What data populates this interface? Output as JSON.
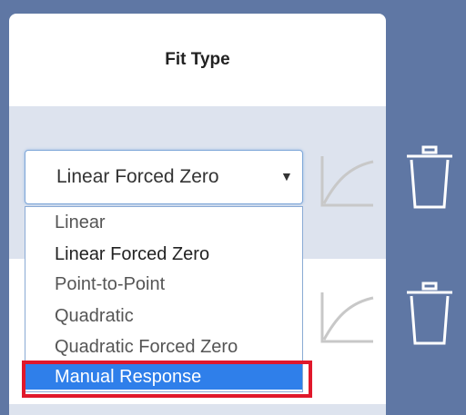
{
  "header": {
    "title": "Fit Type"
  },
  "select": {
    "value": "Linear Forced Zero",
    "arrow": "▼",
    "options": [
      "Linear",
      "Linear Forced Zero",
      "Point-to-Point",
      "Quadratic",
      "Quadratic Forced Zero",
      "Manual Response"
    ],
    "highlighted_option": "Manual Response"
  },
  "icons": {
    "row_1": [
      "curve-chart-icon",
      "trash-icon"
    ],
    "row_2": [
      "curve-chart-icon",
      "trash-icon"
    ]
  },
  "colors": {
    "background": "#5f77a4",
    "row_alt": "#dde3ee",
    "selected_option": "#2f7fea",
    "annotation_box": "#e0182b",
    "icon_gray": "#c8c8c8",
    "icon_white": "#ffffff"
  }
}
